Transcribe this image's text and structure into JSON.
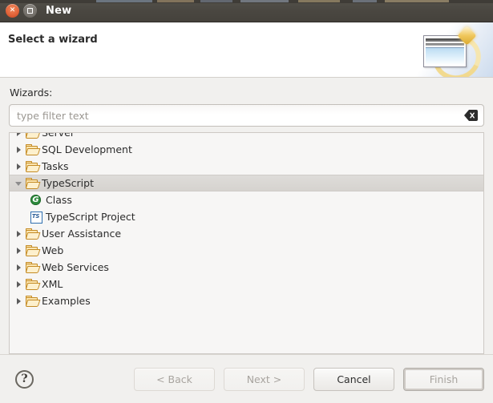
{
  "window": {
    "title": "New",
    "close_icon": "close-icon",
    "maximize_icon": "maximize-icon"
  },
  "banner": {
    "title": "Select a wizard",
    "art_icon": "new-wizard-banner-icon"
  },
  "form": {
    "wizards_label": "Wizards:",
    "filter": {
      "value": "",
      "placeholder": "type filter text",
      "clear_icon": "clear-icon"
    }
  },
  "tree": {
    "items": [
      {
        "label": "Server",
        "icon": "folder-icon",
        "state": "collapsed",
        "level": 0,
        "selected": false,
        "clipped": true
      },
      {
        "label": "SQL Development",
        "icon": "folder-icon",
        "state": "collapsed",
        "level": 0,
        "selected": false
      },
      {
        "label": "Tasks",
        "icon": "folder-icon",
        "state": "collapsed",
        "level": 0,
        "selected": false
      },
      {
        "label": "TypeScript",
        "icon": "folder-icon",
        "state": "expanded",
        "level": 0,
        "selected": true
      },
      {
        "label": "Class",
        "icon": "class-icon",
        "state": "leaf",
        "level": 1,
        "selected": false
      },
      {
        "label": "TypeScript Project",
        "icon": "ts-project-icon",
        "state": "leaf",
        "level": 1,
        "selected": false
      },
      {
        "label": "User Assistance",
        "icon": "folder-icon",
        "state": "collapsed",
        "level": 0,
        "selected": false
      },
      {
        "label": "Web",
        "icon": "folder-icon",
        "state": "collapsed",
        "level": 0,
        "selected": false
      },
      {
        "label": "Web Services",
        "icon": "folder-icon",
        "state": "collapsed",
        "level": 0,
        "selected": false
      },
      {
        "label": "XML",
        "icon": "folder-icon",
        "state": "collapsed",
        "level": 0,
        "selected": false
      },
      {
        "label": "Examples",
        "icon": "folder-icon",
        "state": "collapsed",
        "level": 0,
        "selected": false,
        "clipped": true
      }
    ],
    "icon_glyphs": {
      "class_letter": "G",
      "ts_letter": "TS"
    }
  },
  "buttons": {
    "help": "?",
    "back": "< Back",
    "next": "Next >",
    "cancel": "Cancel",
    "finish": "Finish"
  },
  "colors": {
    "titlebar": "#4a4741",
    "close_button": "#e2643a",
    "body_bg": "#f1f0ee",
    "selection": "#dad7d3",
    "folder_icon": "#c48b26",
    "class_icon": "#2e8b3d",
    "ts_icon": "#2f6fb0"
  }
}
